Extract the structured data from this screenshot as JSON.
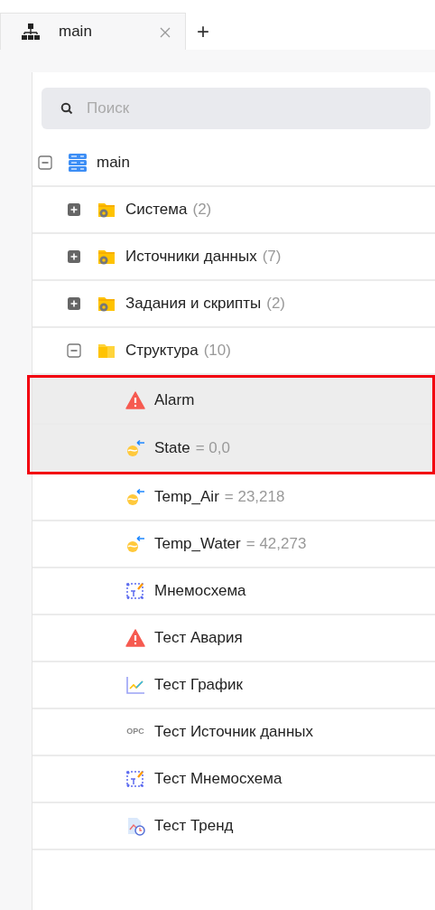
{
  "tabs": [
    {
      "label": "main",
      "selected": true
    }
  ],
  "new_tab": "+",
  "search": {
    "placeholder": "Поиск"
  },
  "tree": [
    {
      "kind": "database",
      "label": "main",
      "expanded": true,
      "selected": false,
      "children": [
        {
          "kind": "folder-gear",
          "label": "Система",
          "count": "(2)",
          "expanded": false,
          "selected": false
        },
        {
          "kind": "folder-gear",
          "label": "Источники данных",
          "count": "(7)",
          "expanded": false,
          "selected": false
        },
        {
          "kind": "folder-gear",
          "label": "Задания и скрипты",
          "count": "(2)",
          "expanded": false,
          "selected": false
        },
        {
          "kind": "folder",
          "label": "Структура",
          "count": "(10)",
          "expanded": true,
          "selected": false,
          "children": [
            {
              "kind": "alarm",
              "label": "Alarm",
              "selected": true
            },
            {
              "kind": "tag",
              "label": "State",
              "value": "= 0,0",
              "selected": true
            },
            {
              "kind": "tag",
              "label": "Temp_Air",
              "value": "= 23,218",
              "selected": false
            },
            {
              "kind": "tag",
              "label": "Temp_Water",
              "value": "= 42,273",
              "selected": false
            },
            {
              "kind": "mimic",
              "label": "Мнемосхема",
              "selected": false
            },
            {
              "kind": "alarm",
              "label": "Тест Авария",
              "selected": false
            },
            {
              "kind": "chart",
              "label": "Тест График",
              "selected": false
            },
            {
              "kind": "opc",
              "icon_text": "OPC",
              "label": "Тест Источник данных",
              "selected": false
            },
            {
              "kind": "mimic",
              "label": "Тест Мнемосхема",
              "selected": false
            },
            {
              "kind": "trend",
              "label": "Тест Тренд",
              "selected": false
            }
          ]
        }
      ]
    }
  ]
}
